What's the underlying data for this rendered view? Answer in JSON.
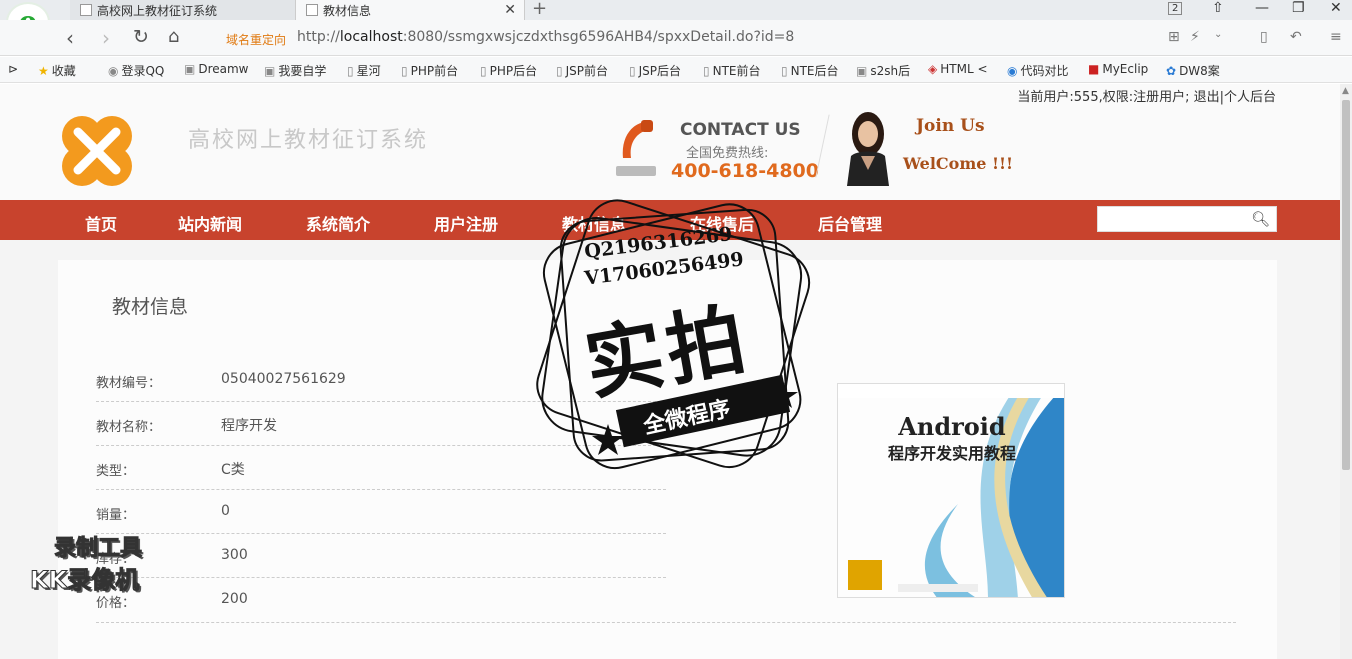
{
  "browser": {
    "tabs": [
      {
        "label": "高校网上教材征订系统"
      },
      {
        "label": "教材信息"
      }
    ],
    "close_glyph": "✕",
    "new_tab_glyph": "+",
    "window_badge": "2",
    "redirect_label": "域名重定向",
    "url_prefix": "http://",
    "url_host": "localhost",
    "url_rest": ":8080/ssmgxwsjczdxthsg6596AHB4/spxxDetail.do?id=8",
    "bookmarks": [
      "收藏",
      "登录QQ",
      "Dreamw",
      "我要自学",
      "星河",
      "PHP前台",
      "PHP后台",
      "JSP前台",
      "JSP后台",
      "NTE前台",
      "NTE后台",
      "s2sh后",
      "HTML <",
      "代码对比",
      "MyEclip",
      "DW8案"
    ]
  },
  "site": {
    "user_info": "当前用户:555,权限:注册用户; 退出|个人后台",
    "name": "高校网上教材征订系统",
    "contact_title": "CONTACT US",
    "contact_sub": "全国免费热线:",
    "contact_number": "400-618-4800",
    "join_us": "Join Us",
    "welcome": "WelCome !!!",
    "nav": [
      "首页",
      "站内新闻",
      "系统简介",
      "用户注册",
      "教材信息",
      "在线售后",
      "后台管理"
    ],
    "search_placeholder": ""
  },
  "detail": {
    "title": "教材信息",
    "fields": [
      {
        "label": "教材编号：",
        "value": "05040027561629"
      },
      {
        "label": "教材名称：",
        "value": "程序开发"
      },
      {
        "label": "类型：",
        "value": "C类"
      },
      {
        "label": "销量：",
        "value": "0"
      },
      {
        "label": "库存：",
        "value": "300"
      },
      {
        "label": "价格：",
        "value": "200"
      }
    ],
    "book_cover_title": "Android",
    "book_cover_subtitle": "程序开发实用教程"
  },
  "overlay": {
    "stamp_q": "Q2196316269",
    "stamp_v": "V1706025649​9",
    "stamp_big": "实拍",
    "stamp_ribbon": "全微程序",
    "recorder_line1": "录制工具",
    "recorder_line2": "KK录像机"
  }
}
